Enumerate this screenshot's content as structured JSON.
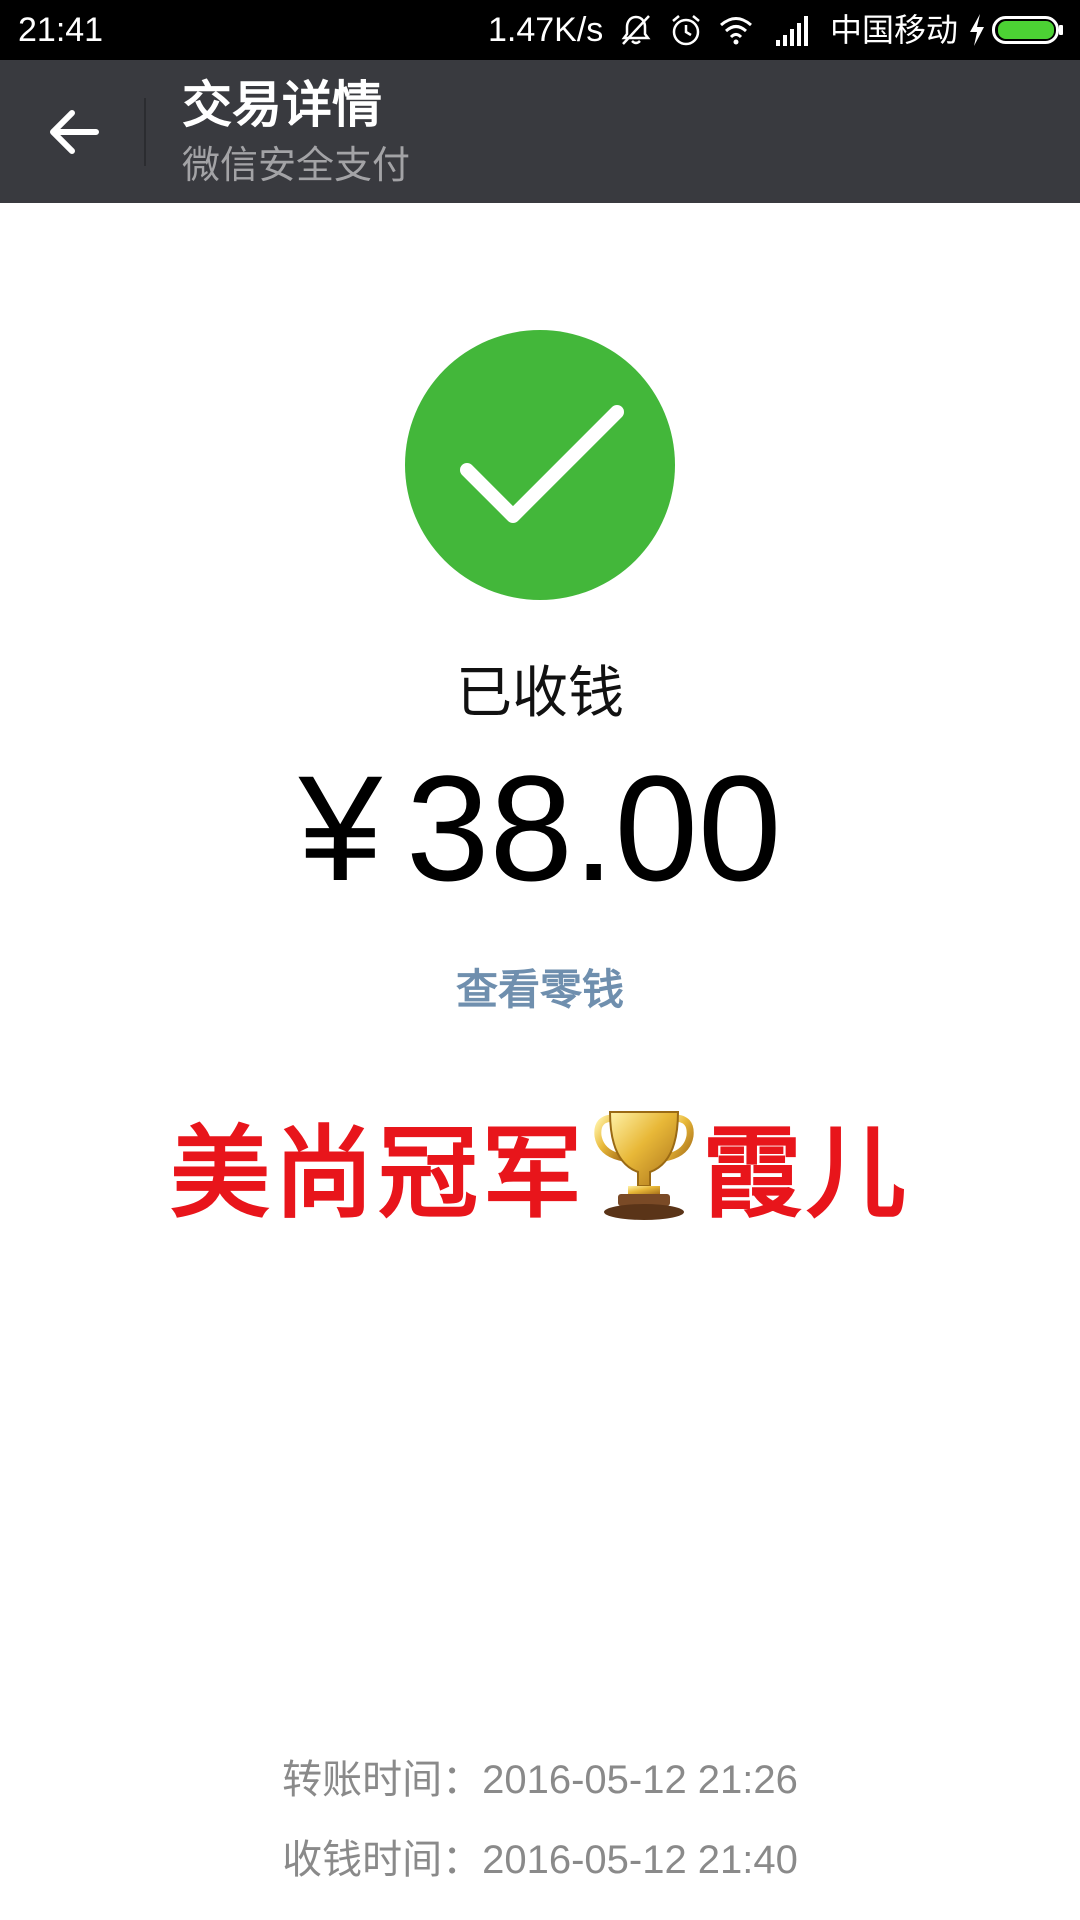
{
  "status_bar": {
    "time": "21:41",
    "net_speed": "1.47K/s",
    "carrier": "中国移动",
    "icons": [
      "bell-muted-icon",
      "alarm-icon",
      "wifi-icon",
      "signal-icon",
      "charging-bolt-icon",
      "battery-icon"
    ],
    "battery_color": "#4cd134"
  },
  "header": {
    "title": "交易详情",
    "subtitle": "微信安全支付",
    "background": "#393a3f",
    "back_icon": "arrow-left-icon"
  },
  "main": {
    "success_icon": "check-circle-icon",
    "success_color": "#43b73a",
    "status": "已收钱",
    "currency_symbol": "¥",
    "amount": "38.00",
    "view_balance_link": "查看零钱",
    "note_part1": "美尚冠军",
    "note_emoji": "trophy-icon",
    "note_part2": "霞儿",
    "note_color": "#e8151b"
  },
  "details": {
    "transfer_time_label": "转账时间：",
    "transfer_time": "2016-05-12 21:26",
    "receive_time_label": "收钱时间：",
    "receive_time": "2016-05-12 21:40"
  }
}
